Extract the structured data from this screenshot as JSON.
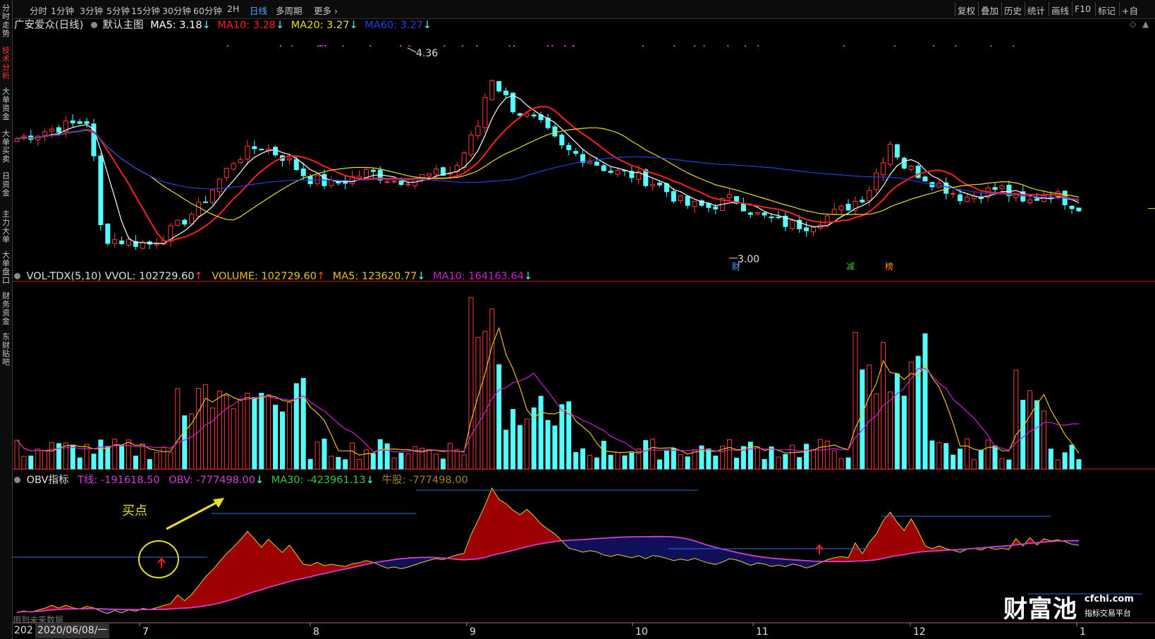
{
  "sidebar": {
    "items": [
      {
        "label": "分时走势",
        "active": false
      },
      {
        "label": "技术分析",
        "active": true
      },
      {
        "label": "大单资金",
        "active": false
      },
      {
        "label": "大单买卖",
        "active": false
      },
      {
        "label": "日资金",
        "active": false
      },
      {
        "label": "主力大单",
        "active": false
      },
      {
        "label": "大单盘口",
        "active": false
      },
      {
        "label": "财务资金",
        "active": false
      },
      {
        "label": "东财贴吧",
        "active": false
      }
    ]
  },
  "toolbar": {
    "periods": [
      "分时",
      "1分钟",
      "3分钟",
      "5分钟",
      "15分钟",
      "30分钟",
      "60分钟",
      "2H",
      "日线",
      "多周期"
    ],
    "active_period": "日线",
    "more": "更多",
    "right_buttons": [
      "复权",
      "叠加",
      "历史",
      "统计",
      "画线",
      "F10",
      "标记",
      "+自"
    ]
  },
  "main_panel": {
    "stock": "广安爱众(日线)",
    "template": "默认主图",
    "ma5": "MA5: 3.18",
    "ma10": "MA10: 3.28",
    "ma20": "MA20: 3.27",
    "ma60": "MA60: 3.27",
    "high_label": "4.36",
    "low_label": "3.00",
    "markers": [
      {
        "text": "财",
        "color": "#4fa8ff"
      },
      {
        "text": "减",
        "color": "#3cc83c"
      },
      {
        "text": "榜",
        "color": "#ff9020"
      }
    ]
  },
  "volume_panel": {
    "title": "VOL-TDX(5,10)",
    "vvol": "VVOL: 102729.60",
    "volume": "VOLUME: 102729.60",
    "ma5": "MA5: 123620.77",
    "ma10": "MA10: 164163.64"
  },
  "obv_panel": {
    "title": "OBV指标",
    "t_line": "T线: -191618.50",
    "obv": "OBV: -777498.00",
    "ma30": "MA30: -423961.13",
    "bull": "牛股: -777498.00",
    "annotation": "买点",
    "notice": "用到未来数据"
  },
  "x_axis": {
    "date_label": "2020/06/08/一",
    "year_stub": "202",
    "months": [
      "7",
      "8",
      "9",
      "10",
      "11",
      "12",
      "1"
    ]
  },
  "watermark": {
    "brand": "财富池",
    "url": "cfchi.com",
    "slogan": "指标交易平台"
  },
  "colors": {
    "up": "#ff3c3c",
    "down": "#54ffff",
    "ma5": "#ffffff",
    "ma10": "#ff2020",
    "ma20": "#e8e020",
    "ma60": "#2040e8",
    "vol_ma5": "#e8c020",
    "vol_ma10": "#d020d0",
    "obv_fill_up": "#9c0000",
    "obv_fill_down": "#10105a",
    "obv_line": "#e8d020",
    "obv_ma": "#d040d0"
  }
}
